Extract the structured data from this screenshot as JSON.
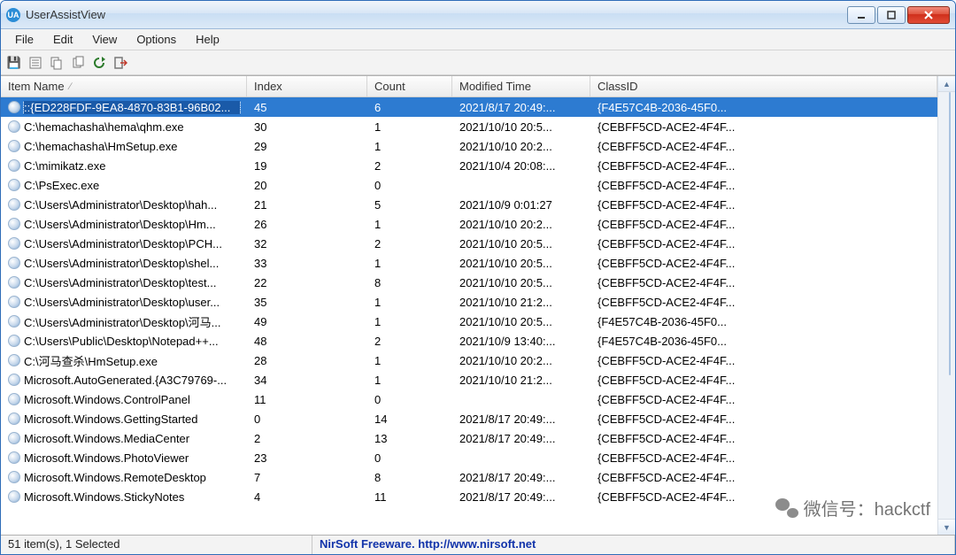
{
  "window": {
    "title": "UserAssistView",
    "app_icon_text": "UA"
  },
  "menubar": {
    "items": [
      "File",
      "Edit",
      "View",
      "Options",
      "Help"
    ]
  },
  "toolbar": {
    "icons": [
      "save-icon",
      "properties-icon",
      "copy-icon",
      "pin-icon",
      "refresh-icon",
      "exit-icon"
    ]
  },
  "columns": {
    "name": "Item Name",
    "index": "Index",
    "count": "Count",
    "mtime": "Modified Time",
    "class": "ClassID"
  },
  "rows": [
    {
      "selected": true,
      "name": "::{ED228FDF-9EA8-4870-83B1-96B02...",
      "index": "45",
      "count": "6",
      "mtime": "2021/8/17 20:49:...",
      "class": "{F4E57C4B-2036-45F0..."
    },
    {
      "selected": false,
      "name": "C:\\hemachasha\\hema\\qhm.exe",
      "index": "30",
      "count": "1",
      "mtime": "2021/10/10 20:5...",
      "class": "{CEBFF5CD-ACE2-4F4F..."
    },
    {
      "selected": false,
      "name": "C:\\hemachasha\\HmSetup.exe",
      "index": "29",
      "count": "1",
      "mtime": "2021/10/10 20:2...",
      "class": "{CEBFF5CD-ACE2-4F4F..."
    },
    {
      "selected": false,
      "name": "C:\\mimikatz.exe",
      "index": "19",
      "count": "2",
      "mtime": "2021/10/4 20:08:...",
      "class": "{CEBFF5CD-ACE2-4F4F..."
    },
    {
      "selected": false,
      "name": "C:\\PsExec.exe",
      "index": "20",
      "count": "0",
      "mtime": "",
      "class": "{CEBFF5CD-ACE2-4F4F..."
    },
    {
      "selected": false,
      "name": "C:\\Users\\Administrator\\Desktop\\hah...",
      "index": "21",
      "count": "5",
      "mtime": "2021/10/9 0:01:27",
      "class": "{CEBFF5CD-ACE2-4F4F..."
    },
    {
      "selected": false,
      "name": "C:\\Users\\Administrator\\Desktop\\Hm...",
      "index": "26",
      "count": "1",
      "mtime": "2021/10/10 20:2...",
      "class": "{CEBFF5CD-ACE2-4F4F..."
    },
    {
      "selected": false,
      "name": "C:\\Users\\Administrator\\Desktop\\PCH...",
      "index": "32",
      "count": "2",
      "mtime": "2021/10/10 20:5...",
      "class": "{CEBFF5CD-ACE2-4F4F..."
    },
    {
      "selected": false,
      "name": "C:\\Users\\Administrator\\Desktop\\shel...",
      "index": "33",
      "count": "1",
      "mtime": "2021/10/10 20:5...",
      "class": "{CEBFF5CD-ACE2-4F4F..."
    },
    {
      "selected": false,
      "name": "C:\\Users\\Administrator\\Desktop\\test...",
      "index": "22",
      "count": "8",
      "mtime": "2021/10/10 20:5...",
      "class": "{CEBFF5CD-ACE2-4F4F..."
    },
    {
      "selected": false,
      "name": "C:\\Users\\Administrator\\Desktop\\user...",
      "index": "35",
      "count": "1",
      "mtime": "2021/10/10 21:2...",
      "class": "{CEBFF5CD-ACE2-4F4F..."
    },
    {
      "selected": false,
      "name": "C:\\Users\\Administrator\\Desktop\\河马...",
      "index": "49",
      "count": "1",
      "mtime": "2021/10/10 20:5...",
      "class": "{F4E57C4B-2036-45F0..."
    },
    {
      "selected": false,
      "name": "C:\\Users\\Public\\Desktop\\Notepad++...",
      "index": "48",
      "count": "2",
      "mtime": "2021/10/9 13:40:...",
      "class": "{F4E57C4B-2036-45F0..."
    },
    {
      "selected": false,
      "name": "C:\\河马查杀\\HmSetup.exe",
      "index": "28",
      "count": "1",
      "mtime": "2021/10/10 20:2...",
      "class": "{CEBFF5CD-ACE2-4F4F..."
    },
    {
      "selected": false,
      "name": "Microsoft.AutoGenerated.{A3C79769-...",
      "index": "34",
      "count": "1",
      "mtime": "2021/10/10 21:2...",
      "class": "{CEBFF5CD-ACE2-4F4F..."
    },
    {
      "selected": false,
      "name": "Microsoft.Windows.ControlPanel",
      "index": "11",
      "count": "0",
      "mtime": "",
      "class": "{CEBFF5CD-ACE2-4F4F..."
    },
    {
      "selected": false,
      "name": "Microsoft.Windows.GettingStarted",
      "index": "0",
      "count": "14",
      "mtime": "2021/8/17 20:49:...",
      "class": "{CEBFF5CD-ACE2-4F4F..."
    },
    {
      "selected": false,
      "name": "Microsoft.Windows.MediaCenter",
      "index": "2",
      "count": "13",
      "mtime": "2021/8/17 20:49:...",
      "class": "{CEBFF5CD-ACE2-4F4F..."
    },
    {
      "selected": false,
      "name": "Microsoft.Windows.PhotoViewer",
      "index": "23",
      "count": "0",
      "mtime": "",
      "class": "{CEBFF5CD-ACE2-4F4F..."
    },
    {
      "selected": false,
      "name": "Microsoft.Windows.RemoteDesktop",
      "index": "7",
      "count": "8",
      "mtime": "2021/8/17 20:49:...",
      "class": "{CEBFF5CD-ACE2-4F4F..."
    },
    {
      "selected": false,
      "name": "Microsoft.Windows.StickyNotes",
      "index": "4",
      "count": "11",
      "mtime": "2021/8/17 20:49:...",
      "class": "{CEBFF5CD-ACE2-4F4F..."
    }
  ],
  "statusbar": {
    "left": "51 item(s), 1 Selected",
    "right": "NirSoft Freeware.  http://www.nirsoft.net"
  },
  "watermark": "微信号：hackctf"
}
